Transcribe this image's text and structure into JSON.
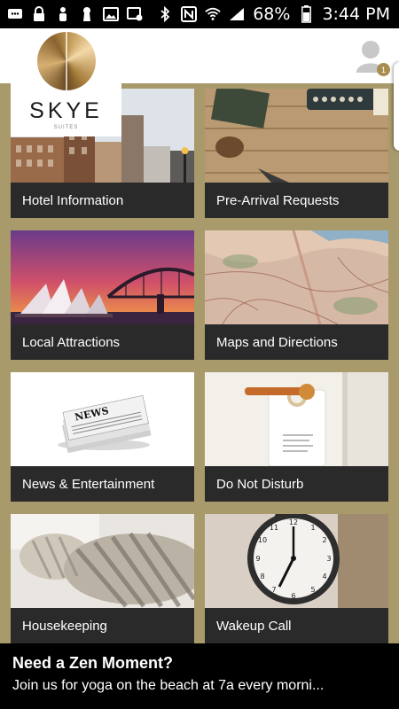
{
  "status_bar": {
    "battery_percent": "68%",
    "time": "3:44 PM"
  },
  "brand": {
    "name": "SKYE",
    "sub": "SUITES"
  },
  "profile": {
    "badge_count": "1"
  },
  "tiles": [
    {
      "label": "Hotel Information"
    },
    {
      "label": "Pre-Arrival Requests"
    },
    {
      "label": "Local Attractions"
    },
    {
      "label": "Maps and Directions"
    },
    {
      "label": "News & Entertainment",
      "image_text": "NEWS"
    },
    {
      "label": "Do Not Disturb"
    },
    {
      "label": "Housekeeping"
    },
    {
      "label": "Wakeup Call"
    }
  ],
  "banner": {
    "title": "Need a Zen Moment?",
    "text": "Join us for yoga on the beach at 7a every morni..."
  },
  "colors": {
    "background": "#a89a6a",
    "tile_label_bg": "#2a2a2a",
    "banner_bg": "#000000",
    "badge": "#a88d4f"
  }
}
